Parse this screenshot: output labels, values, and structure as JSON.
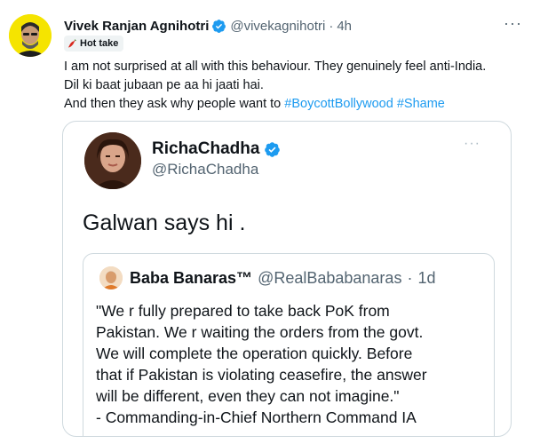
{
  "tweet": {
    "author_name": "Vivek Ranjan Agnihotri",
    "handle": "@vivekagnihotri",
    "separator": "·",
    "time": "4h",
    "badge_label": "Hot take",
    "body_lines": [
      "I am not surprised at all with this behaviour. They genuinely feel anti-India.",
      "Dil ki baat jubaan pe aa hi jaati hai."
    ],
    "last_line_prefix": "And then they ask why people want to ",
    "hashtags": [
      "#BoycottBollywood",
      "#Shame"
    ],
    "more_label": "···"
  },
  "quoted": {
    "author_name": "RichaChadha",
    "handle": "@RichaChadha",
    "more_label": "···",
    "text": "Galwan says hi .",
    "inner": {
      "author_name": "Baba Banaras™",
      "handle": "@RealBababanaras",
      "separator": "·",
      "time": "1d",
      "lines": [
        "\"We r fully prepared to take back PoK from",
        "Pakistan. We r waiting the orders from the govt.",
        "We will complete the operation quickly. Before",
        "that if Pakistan is violating ceasefire, the answer",
        "will be different, even they can not imagine.\"",
        "- Commanding-in-Chief Northern Command IA"
      ]
    }
  },
  "colors": {
    "link": "#1d9bf0",
    "verified": "#1d9bf0",
    "secondary_text": "#536471",
    "border": "#cfd9de"
  },
  "icons": [
    "verified-badge-icon",
    "chili-pepper-icon",
    "more-options-icon"
  ]
}
